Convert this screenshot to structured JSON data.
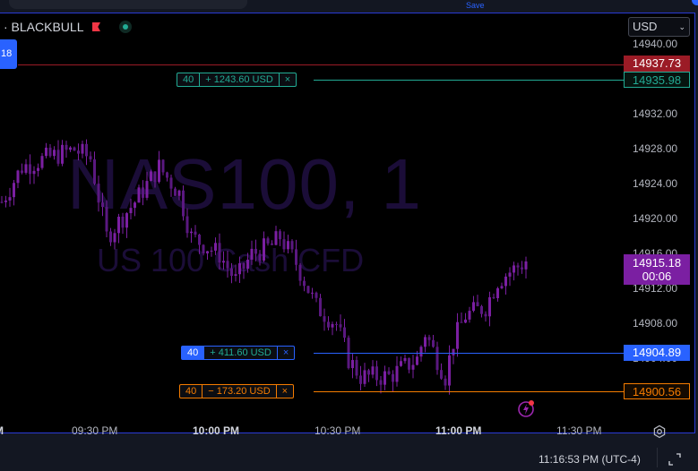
{
  "toolbar": {
    "save_label": "Save"
  },
  "symbol": {
    "title": "· BLACKBULL",
    "left_tag": "18",
    "watermark": "NAS100, 1",
    "watermark_sub": "US 100 Cash CFD"
  },
  "currency": {
    "value": "USD"
  },
  "price_axis": {
    "ticks": [
      "14940.00",
      "14932.00",
      "14928.00",
      "14924.00",
      "14920.00",
      "14916.00",
      "14912.00",
      "14908.00",
      "14904.00"
    ]
  },
  "lines": {
    "ask": {
      "price": "14937.73",
      "color": "#9b1b26"
    },
    "take_profit": {
      "price": "14935.98",
      "qty": "40",
      "pnl": "+ 1243.60 USD",
      "close": "×",
      "color": "#22ab94"
    },
    "current": {
      "price": "14915.18",
      "countdown": "00:06",
      "color": "#7b1fa2"
    },
    "position": {
      "price": "14904.89",
      "qty": "40",
      "pnl": "+ 411.60 USD",
      "close": "×",
      "color": "#2962ff"
    },
    "stop_loss": {
      "price": "14900.56",
      "qty": "40",
      "pnl": "− 173.20 USD",
      "close": "×",
      "color": "#f57c00"
    }
  },
  "time_axis": {
    "labels": [
      {
        "t": "M",
        "bold": true
      },
      {
        "t": "09:30 PM"
      },
      {
        "t": "10:00 PM",
        "bold": true
      },
      {
        "t": "10:30 PM"
      },
      {
        "t": "11:00 PM",
        "bold": true
      },
      {
        "t": "11:30 PM"
      }
    ]
  },
  "chart_data": {
    "type": "candlestick",
    "interval": "1 minute",
    "candle_color": "#7b1fa2",
    "approx_closes": [
      [
        "09:06 PM",
        14922
      ],
      [
        "09:11 PM",
        14926
      ],
      [
        "09:17 PM",
        14927
      ],
      [
        "09:24 PM",
        14928
      ],
      [
        "09:28 PM",
        14927
      ],
      [
        "09:32 PM",
        14918
      ],
      [
        "09:39 PM",
        14922
      ],
      [
        "09:45 PM",
        14926
      ],
      [
        "09:50 PM",
        14923
      ],
      [
        "09:53 PM",
        14918
      ],
      [
        "10:00 PM",
        14916
      ],
      [
        "10:04 PM",
        14913
      ],
      [
        "10:08 PM",
        14916
      ],
      [
        "10:13 PM",
        14917
      ],
      [
        "10:15 PM",
        14918
      ],
      [
        "10:19 PM",
        14915
      ],
      [
        "10:24 PM",
        14910
      ],
      [
        "10:29 PM",
        14908
      ],
      [
        "10:32 PM",
        14904
      ],
      [
        "10:35 PM",
        14902
      ],
      [
        "10:42 PM",
        14902
      ],
      [
        "10:49 PM",
        14904
      ],
      [
        "10:51 PM",
        14907
      ],
      [
        "10:56 PM",
        14902
      ],
      [
        "10:58 PM",
        14906
      ],
      [
        "11:01 PM",
        14909
      ],
      [
        "11:06 PM",
        14910
      ],
      [
        "11:09 PM",
        14913
      ],
      [
        "11:12 PM",
        14914
      ],
      [
        "11:16 PM",
        14915.18
      ]
    ]
  },
  "status": {
    "time": "11:16:53 PM (UTC-4)"
  }
}
